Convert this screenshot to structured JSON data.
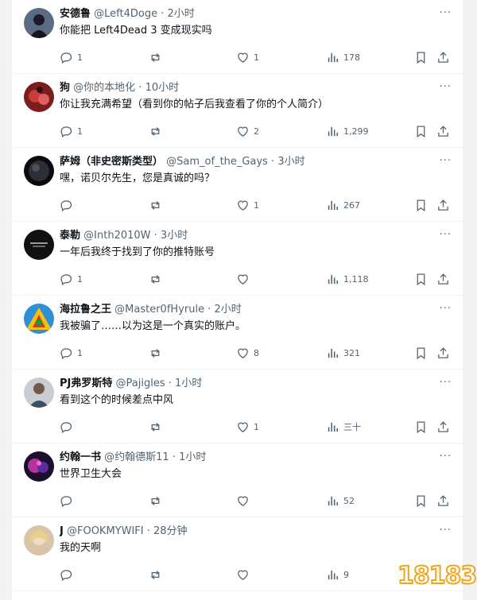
{
  "tweets": [
    {
      "name": "安德鲁",
      "handle": "@Left4Doge",
      "time": "2小时",
      "text": "你能把 Left4Dead 3 变成现实吗",
      "replies": "1",
      "retweets": "",
      "likes": "1",
      "views": "178"
    },
    {
      "name": "狗",
      "handle": "@你的本地化",
      "time": "10小时",
      "text": "你让我充满希望（看到你的帖子后我查看了你的个人简介）",
      "replies": "1",
      "retweets": "",
      "likes": "2",
      "views": "1,299"
    },
    {
      "name": "萨姆（非史密斯类型）",
      "handle": "@Sam_of_the_Gays",
      "time": "3小时",
      "text": "嘿，诺贝尔先生，您是真诚的吗？",
      "replies": "",
      "retweets": "",
      "likes": "1",
      "views": "267"
    },
    {
      "name": "泰勒",
      "handle": "@Inth2010W",
      "time": "3小时",
      "text": "一年后我终于找到了你的推特账号",
      "replies": "1",
      "retweets": "",
      "likes": "",
      "views": "1,118"
    },
    {
      "name": "海拉鲁之王",
      "handle": "@Master0fHyrule",
      "time": "2小时",
      "text": "我被骗了……以为这是一个真实的账户。",
      "replies": "1",
      "retweets": "",
      "likes": "8",
      "views": "321"
    },
    {
      "name": "PJ弗罗斯特",
      "handle": "@Pajigles",
      "time": "1小时",
      "text": "看到这个的时候差点中风",
      "replies": "",
      "retweets": "",
      "likes": "1",
      "views": "三十"
    },
    {
      "name": "约翰一书",
      "handle": "@约翰德斯11",
      "time": "1小时",
      "text": "世界卫生大会",
      "replies": "",
      "retweets": "",
      "likes": "",
      "views": "52"
    },
    {
      "name": "J",
      "handle": "@FOOKMYWIFI",
      "time": "28分钟",
      "text": "我的天啊",
      "replies": "",
      "retweets": "",
      "likes": "",
      "views": "9"
    }
  ],
  "separator": " · ",
  "more_label": "···",
  "watermark": "18183",
  "icons": {
    "reply": "reply-icon",
    "retweet": "retweet-icon",
    "like": "heart-icon",
    "views": "views-icon",
    "bookmark": "bookmark-icon",
    "share": "share-icon"
  },
  "colors": {
    "text": "#0f1419",
    "muted": "#536471",
    "border": "#eff3f4",
    "watermark": "#f2a51a"
  }
}
